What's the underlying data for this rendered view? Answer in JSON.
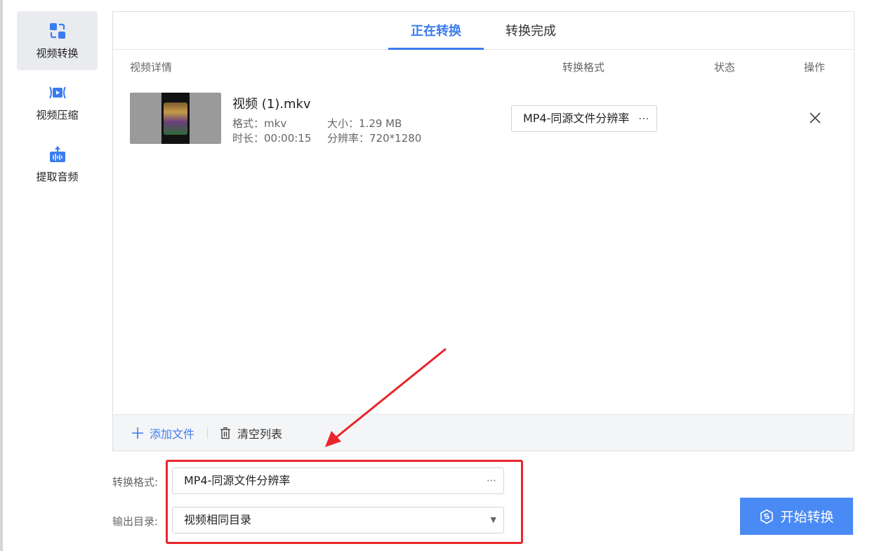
{
  "sidebar": {
    "items": [
      {
        "label": "视频转换",
        "icon": "convert-icon",
        "active": true
      },
      {
        "label": "视频压缩",
        "icon": "compress-icon",
        "active": false
      },
      {
        "label": "提取音频",
        "icon": "audio-extract-icon",
        "active": false
      }
    ]
  },
  "tabs": [
    {
      "label": "正在转换",
      "active": true
    },
    {
      "label": "转换完成",
      "active": false
    }
  ],
  "table": {
    "headers": {
      "details": "视频详情",
      "format": "转换格式",
      "status": "状态",
      "action": "操作"
    },
    "rows": [
      {
        "name": "视频 (1).mkv",
        "format_label": "格式：",
        "format_value": "mkv",
        "size_label": "大小：",
        "size_value": "1.29 MB",
        "duration_label": "时长：",
        "duration_value": "00:00:15",
        "resolution_label": "分辨率：",
        "resolution_value": "720*1280",
        "target_format": "MP4-同源文件分辨率",
        "status": ""
      }
    ]
  },
  "footer": {
    "add_label": "添加文件",
    "clear_label": "清空列表"
  },
  "settings": {
    "format_label": "转换格式:",
    "format_value": "MP4-同源文件分辨率",
    "output_label": "输出目录:",
    "output_value": "视频相同目录"
  },
  "start_button": {
    "label": "开始转换"
  },
  "colors": {
    "accent": "#3b7cf0",
    "button": "#4a8af4",
    "highlight": "#e8262b"
  }
}
